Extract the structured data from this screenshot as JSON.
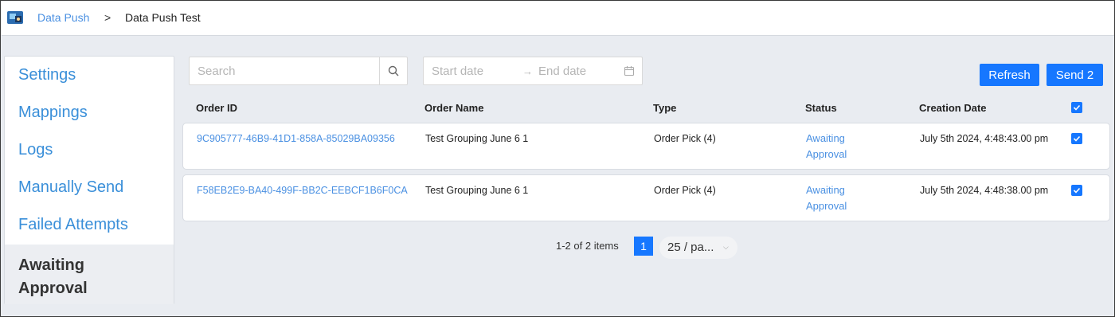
{
  "breadcrumb": {
    "parent": "Data Push",
    "separator": ">",
    "current": "Data Push Test"
  },
  "sidebar": {
    "items": [
      {
        "label": "Settings"
      },
      {
        "label": "Mappings"
      },
      {
        "label": "Logs"
      },
      {
        "label": "Manually Send"
      },
      {
        "label": "Failed Attempts"
      },
      {
        "label": "Awaiting Approval"
      }
    ],
    "active": "Awaiting Approval"
  },
  "search": {
    "placeholder": "Search",
    "value": ""
  },
  "date_range": {
    "start_placeholder": "Start date",
    "arrow": "→",
    "end_placeholder": "End date"
  },
  "toolbar": {
    "refresh_label": "Refresh",
    "send_label": "Send 2"
  },
  "table": {
    "headers": [
      "Order ID",
      "Order Name",
      "Type",
      "Status",
      "Creation Date"
    ],
    "rows": [
      {
        "order_id": "9C905777-46B9-41D1-858A-85029BA09356",
        "order_name": "Test Grouping June 6 1",
        "type": "Order Pick (4)",
        "status_line1": "Awaiting",
        "status_line2": "Approval",
        "creation_date": "July 5th 2024, 4:48:43.00 pm",
        "checked": true
      },
      {
        "order_id": "F58EB2E9-BA40-499F-BB2C-EEBCF1B6F0CA",
        "order_name": "Test Grouping June 6 1",
        "type": "Order Pick (4)",
        "status_line1": "Awaiting",
        "status_line2": "Approval",
        "creation_date": "July 5th 2024, 4:48:38.00 pm",
        "checked": true
      }
    ]
  },
  "pagination": {
    "summary": "1-2 of 2 items",
    "current_page": "1",
    "page_size": "25 / pa..."
  },
  "colors": {
    "primary": "#1677ff",
    "link": "#4a90e2",
    "background": "#e9ecf1"
  }
}
